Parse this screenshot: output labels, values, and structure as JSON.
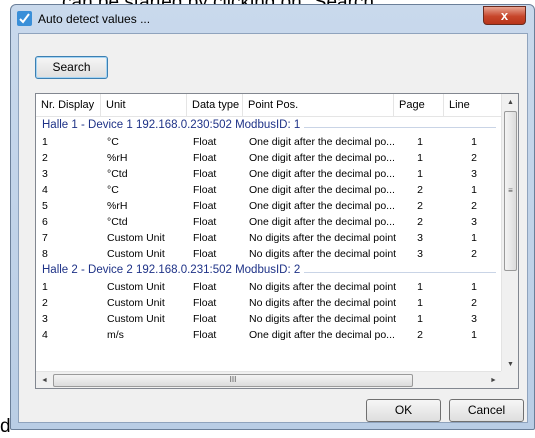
{
  "background": {
    "top_text": "can be started by clicking on \"Search\".",
    "bottom_text": "d"
  },
  "window": {
    "title": "Auto detect values ...",
    "close_label": "x"
  },
  "toolbar": {
    "search_label": "Search"
  },
  "columns": [
    "Nr. Display",
    "Unit",
    "Data type",
    "Point Pos.",
    "Page",
    "Line"
  ],
  "groups": [
    {
      "title": "Halle 1 - Device 1 192.168.0.230:502 ModbusID: 1",
      "rows": [
        [
          "1",
          "°C",
          "Float",
          "One digit after the decimal po...",
          "1",
          "1"
        ],
        [
          "2",
          "%rH",
          "Float",
          "One digit after the decimal po...",
          "1",
          "2"
        ],
        [
          "3",
          "°Ctd",
          "Float",
          "One digit after the decimal po...",
          "1",
          "3"
        ],
        [
          "4",
          "°C",
          "Float",
          "One digit after the decimal po...",
          "2",
          "1"
        ],
        [
          "5",
          "%rH",
          "Float",
          "One digit after the decimal po...",
          "2",
          "2"
        ],
        [
          "6",
          "°Ctd",
          "Float",
          "One digit after the decimal po...",
          "2",
          "3"
        ],
        [
          "7",
          "Custom Unit",
          "Float",
          "No digits after the decimal point",
          "3",
          "1"
        ],
        [
          "8",
          "Custom Unit",
          "Float",
          "No digits after the decimal point",
          "3",
          "2"
        ]
      ]
    },
    {
      "title": "Halle 2 - Device 2 192.168.0.231:502 ModbusID: 2",
      "rows": [
        [
          "1",
          "Custom Unit",
          "Float",
          "No digits after the decimal point",
          "1",
          "1"
        ],
        [
          "2",
          "Custom Unit",
          "Float",
          "No digits after the decimal point",
          "1",
          "2"
        ],
        [
          "3",
          "Custom Unit",
          "Float",
          "No digits after the decimal point",
          "1",
          "3"
        ],
        [
          "4",
          "m/s",
          "Float",
          "One digit after the decimal po...",
          "2",
          "1"
        ]
      ]
    }
  ],
  "scrollbar": {
    "up": "▲",
    "down": "▼",
    "left": "◄",
    "right": "►",
    "v_grip": "≡",
    "h_grip": "III"
  },
  "footer": {
    "ok_label": "OK",
    "cancel_label": "Cancel"
  },
  "colors": {
    "group_text": "#1e3287",
    "window_frame": "#b9cde5",
    "close_button": "#c7462b"
  }
}
